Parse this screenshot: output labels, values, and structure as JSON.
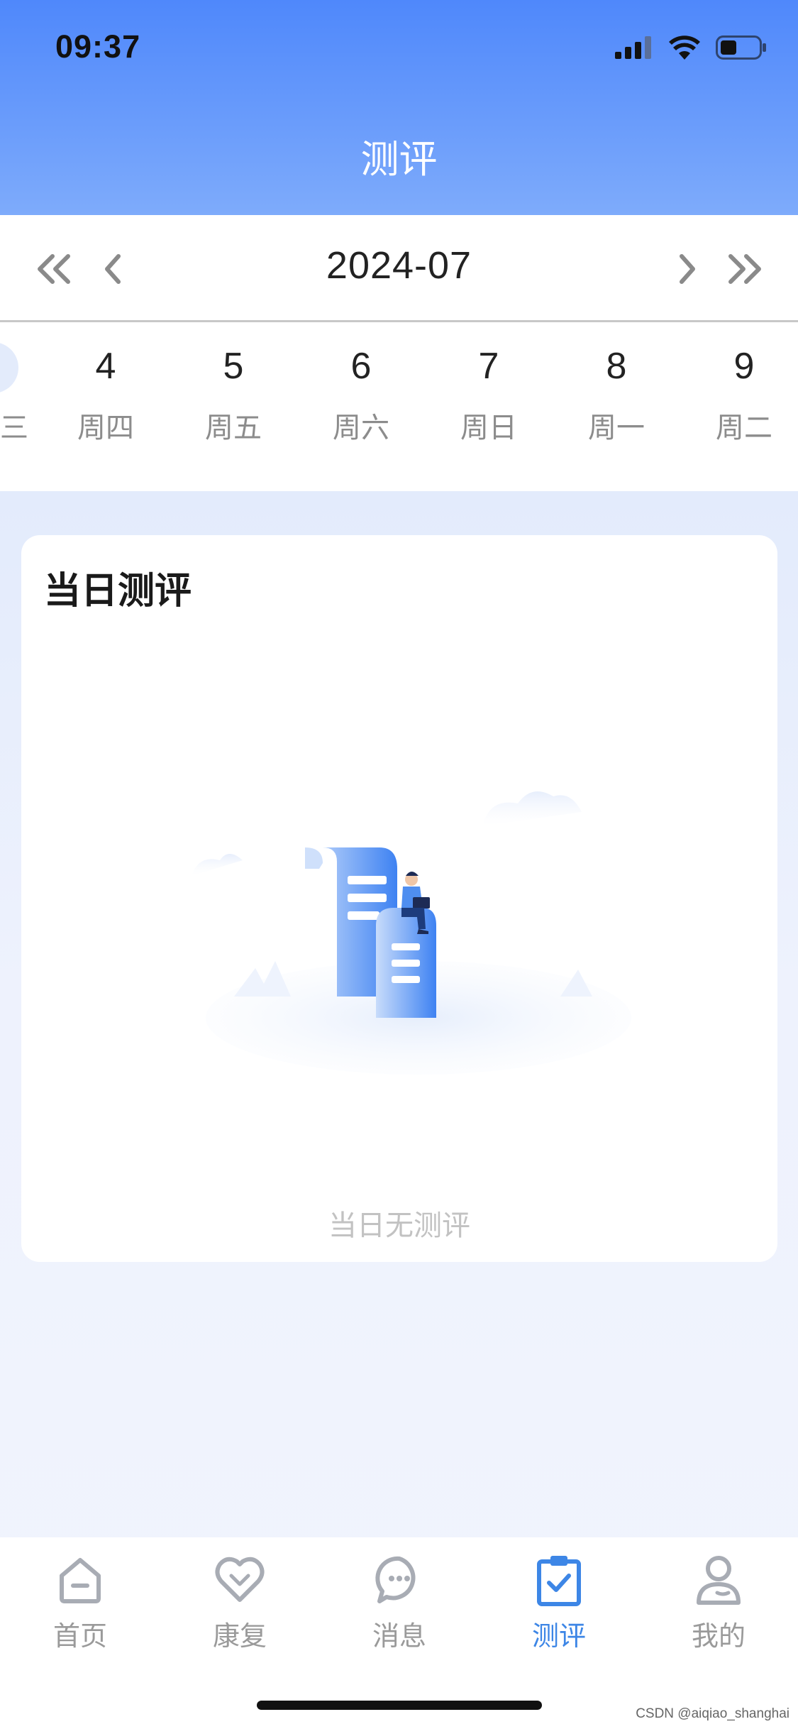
{
  "status_bar": {
    "time": "09:37"
  },
  "header": {
    "title": "测评"
  },
  "month_nav": {
    "month": "2024-07"
  },
  "week": {
    "partial_left_label": "三",
    "days": [
      {
        "num": "4",
        "weekday": "周四"
      },
      {
        "num": "5",
        "weekday": "周五"
      },
      {
        "num": "6",
        "weekday": "周六"
      },
      {
        "num": "7",
        "weekday": "周日"
      },
      {
        "num": "8",
        "weekday": "周一"
      },
      {
        "num": "9",
        "weekday": "周二"
      }
    ]
  },
  "card": {
    "title": "当日测评",
    "empty_text": "当日无测评"
  },
  "tabbar": {
    "tabs": [
      {
        "label": "首页",
        "icon": "home-icon",
        "active": false
      },
      {
        "label": "康复",
        "icon": "heart-icon",
        "active": false
      },
      {
        "label": "消息",
        "icon": "message-icon",
        "active": false
      },
      {
        "label": "测评",
        "icon": "clipboard-check-icon",
        "active": true
      },
      {
        "label": "我的",
        "icon": "user-icon",
        "active": false
      }
    ]
  },
  "colors": {
    "accent": "#3d86e6",
    "header_top": "#4f88fb",
    "header_bottom": "#7eabfb"
  },
  "watermark": "CSDN @aiqiao_shanghai"
}
